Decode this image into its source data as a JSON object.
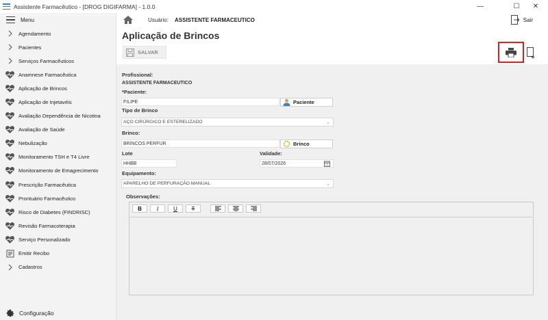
{
  "window": {
    "title": "Assistente Farmacêutico - [DROG DIGIFARMA] - 1.0.0",
    "minimize_glyph": "—",
    "maximize_glyph": "☐",
    "close_glyph": "✕"
  },
  "sidebar": {
    "menu_label": "Menu",
    "items": [
      {
        "label": "Agendamento",
        "icon": "chevron-right-icon"
      },
      {
        "label": "Pacientes",
        "icon": "chevron-right-icon"
      },
      {
        "label": "Serviços Farmacêuticos",
        "icon": "chevron-right-icon"
      },
      {
        "label": "Anamnese Farmacêutica",
        "icon": "heart-pulse-icon"
      },
      {
        "label": "Aplicação de Brincos",
        "icon": "heart-pulse-icon"
      },
      {
        "label": "Aplicação de Injetavéis",
        "icon": "heart-pulse-icon"
      },
      {
        "label": "Avaliação Dependência de Nicotina",
        "icon": "heart-pulse-icon"
      },
      {
        "label": "Avaliação de Saúde",
        "icon": "heart-pulse-icon"
      },
      {
        "label": "Nebulização",
        "icon": "heart-pulse-icon"
      },
      {
        "label": "Monitoramento TSH e T4 Livre",
        "icon": "heart-pulse-icon"
      },
      {
        "label": "Monitoramento de Emagrecimento",
        "icon": "heart-pulse-icon"
      },
      {
        "label": "Prescrição Farmacêutica",
        "icon": "heart-pulse-icon"
      },
      {
        "label": "Prontuário Farmacêutico",
        "icon": "heart-pulse-icon"
      },
      {
        "label": "Risco de Diabetes (FINDRISC)",
        "icon": "heart-pulse-icon"
      },
      {
        "label": "Revisão Farmacoterapia",
        "icon": "heart-pulse-icon"
      },
      {
        "label": "Serviço Personalizado",
        "icon": "heart-pulse-icon"
      },
      {
        "label": "Emitir Recibo",
        "icon": "receipt-icon"
      },
      {
        "label": "Cadastros",
        "icon": "chevron-right-icon"
      }
    ],
    "config_label": "Configuração"
  },
  "header": {
    "user_label": "Usuário:",
    "user_name": "ASSISTENTE FARMACEUTICO",
    "logout_label": "Sair"
  },
  "page": {
    "title": "Aplicação de Brincos",
    "save_label": "SALVAR"
  },
  "form": {
    "profissional_label": "Profissional:",
    "profissional_value": "ASSISTENTE FARMACEUTICO",
    "paciente_label": "*Paciente:",
    "paciente_value": "FILIPE",
    "paciente_button": "Paciente",
    "tipo_label": "Tipo de Brinco",
    "tipo_value": "AÇO CIRÚRGICO E ESTERELIZADO",
    "brinco_label": "Brinco:",
    "brinco_value": "BRINCOS PERFUR",
    "brinco_button": "Brinco",
    "lote_label": "Lote",
    "lote_value": "HHBB",
    "validade_label": "Validade:",
    "validade_value": "28/07/2026",
    "equipamento_label": "Equipamento:",
    "equipamento_value": "APARELHO DE PERFURAÇÃO MANUAL",
    "observacoes_label": "Observações:"
  },
  "editor_toolbar": {
    "bold": "B",
    "italic": "I",
    "underline": "U",
    "strike": "T"
  },
  "colors": {
    "highlight": "#d82020",
    "sidebar_bg": "#f3f3f3",
    "content_bg": "#f0f0f0"
  }
}
